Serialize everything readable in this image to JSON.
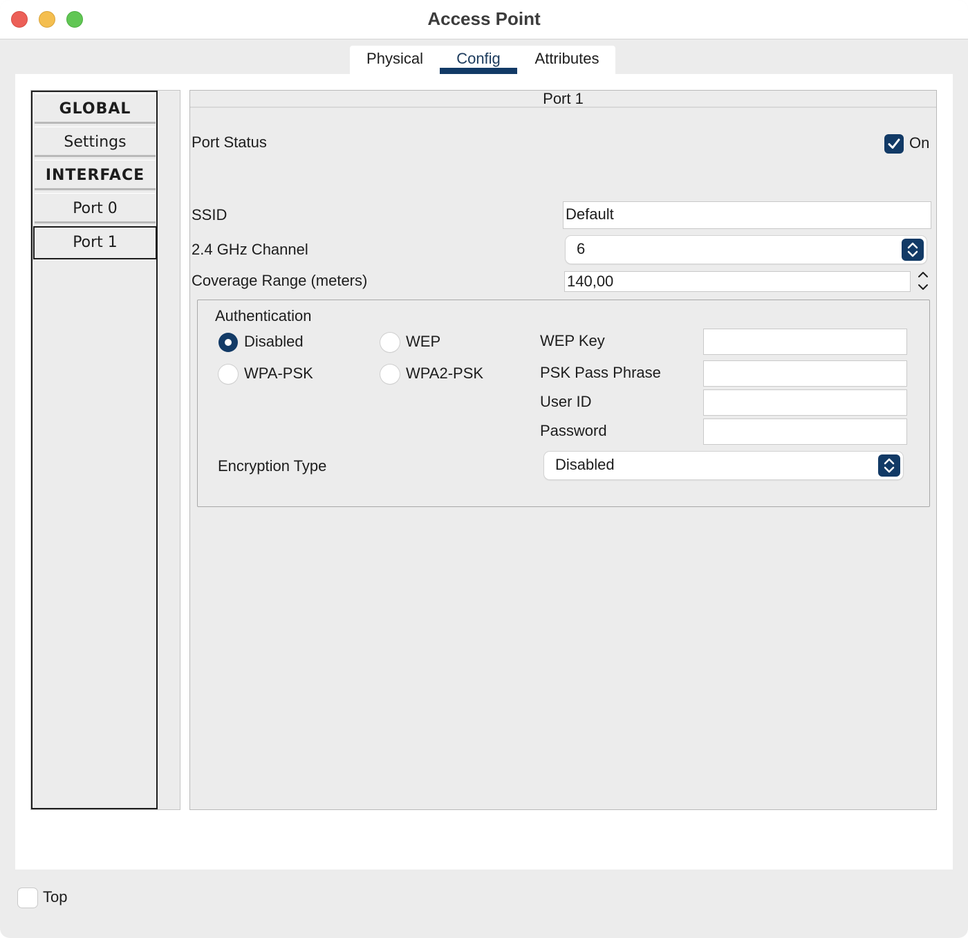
{
  "window": {
    "title": "Access Point"
  },
  "tabs": [
    {
      "label": "Physical"
    },
    {
      "label": "Config",
      "active": true
    },
    {
      "label": "Attributes"
    }
  ],
  "sidebar": {
    "items": [
      {
        "label": "GLOBAL",
        "type": "header"
      },
      {
        "label": "Settings"
      },
      {
        "label": "INTERFACE",
        "type": "header"
      },
      {
        "label": "Port 0"
      },
      {
        "label": "Port 1",
        "selected": true
      }
    ]
  },
  "content": {
    "header": "Port 1",
    "port_status": {
      "label": "Port Status",
      "checkbox_label": "On",
      "checked": true
    },
    "ssid": {
      "label": "SSID",
      "value": "Default"
    },
    "channel": {
      "label": "2.4 GHz Channel",
      "value": "6"
    },
    "coverage": {
      "label": "Coverage Range (meters)",
      "value": "140,00"
    },
    "authentication": {
      "title": "Authentication",
      "options": [
        {
          "label": "Disabled",
          "checked": true
        },
        {
          "label": "WEP",
          "checked": false
        },
        {
          "label": "WPA-PSK",
          "checked": false
        },
        {
          "label": "WPA2-PSK",
          "checked": false
        }
      ],
      "fields": [
        {
          "label": "WEP Key",
          "value": ""
        },
        {
          "label": "PSK Pass Phrase",
          "value": ""
        },
        {
          "label": "User ID",
          "value": ""
        },
        {
          "label": "Password",
          "value": ""
        }
      ],
      "encryption": {
        "label": "Encryption Type",
        "value": "Disabled"
      }
    }
  },
  "footer": {
    "top_checkbox_label": "Top",
    "checked": false
  },
  "colors": {
    "accent": "#123a66",
    "close": "#ec5f57",
    "minimize": "#f4be4f",
    "maximize": "#61c654"
  },
  "icons": [
    "close-button",
    "minimize-button",
    "maximize-button",
    "checkmark-icon",
    "chevron-updown-icon",
    "chevron-up-icon",
    "chevron-down-icon"
  ]
}
